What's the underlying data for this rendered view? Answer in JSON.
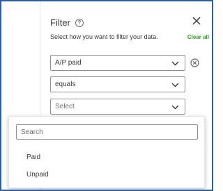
{
  "filter": {
    "title": "Filter",
    "subtitle": "Select how you want to filter your data.",
    "clear_all_label": "Clear all",
    "field_select": {
      "value": "A/P paid"
    },
    "operator_select": {
      "value": "equals"
    },
    "value_select": {
      "placeholder": "Select"
    }
  },
  "dropdown": {
    "search_placeholder": "Search",
    "options": [
      "Paid",
      "Unpaid"
    ]
  },
  "icons": {
    "help": "help-circle-icon",
    "close": "close-icon",
    "remove": "remove-circle-icon",
    "chevron": "chevron-down-icon"
  },
  "colors": {
    "accent_green": "#2ca01c",
    "frame_blue": "#2a5ca8",
    "text": "#393a3d"
  }
}
